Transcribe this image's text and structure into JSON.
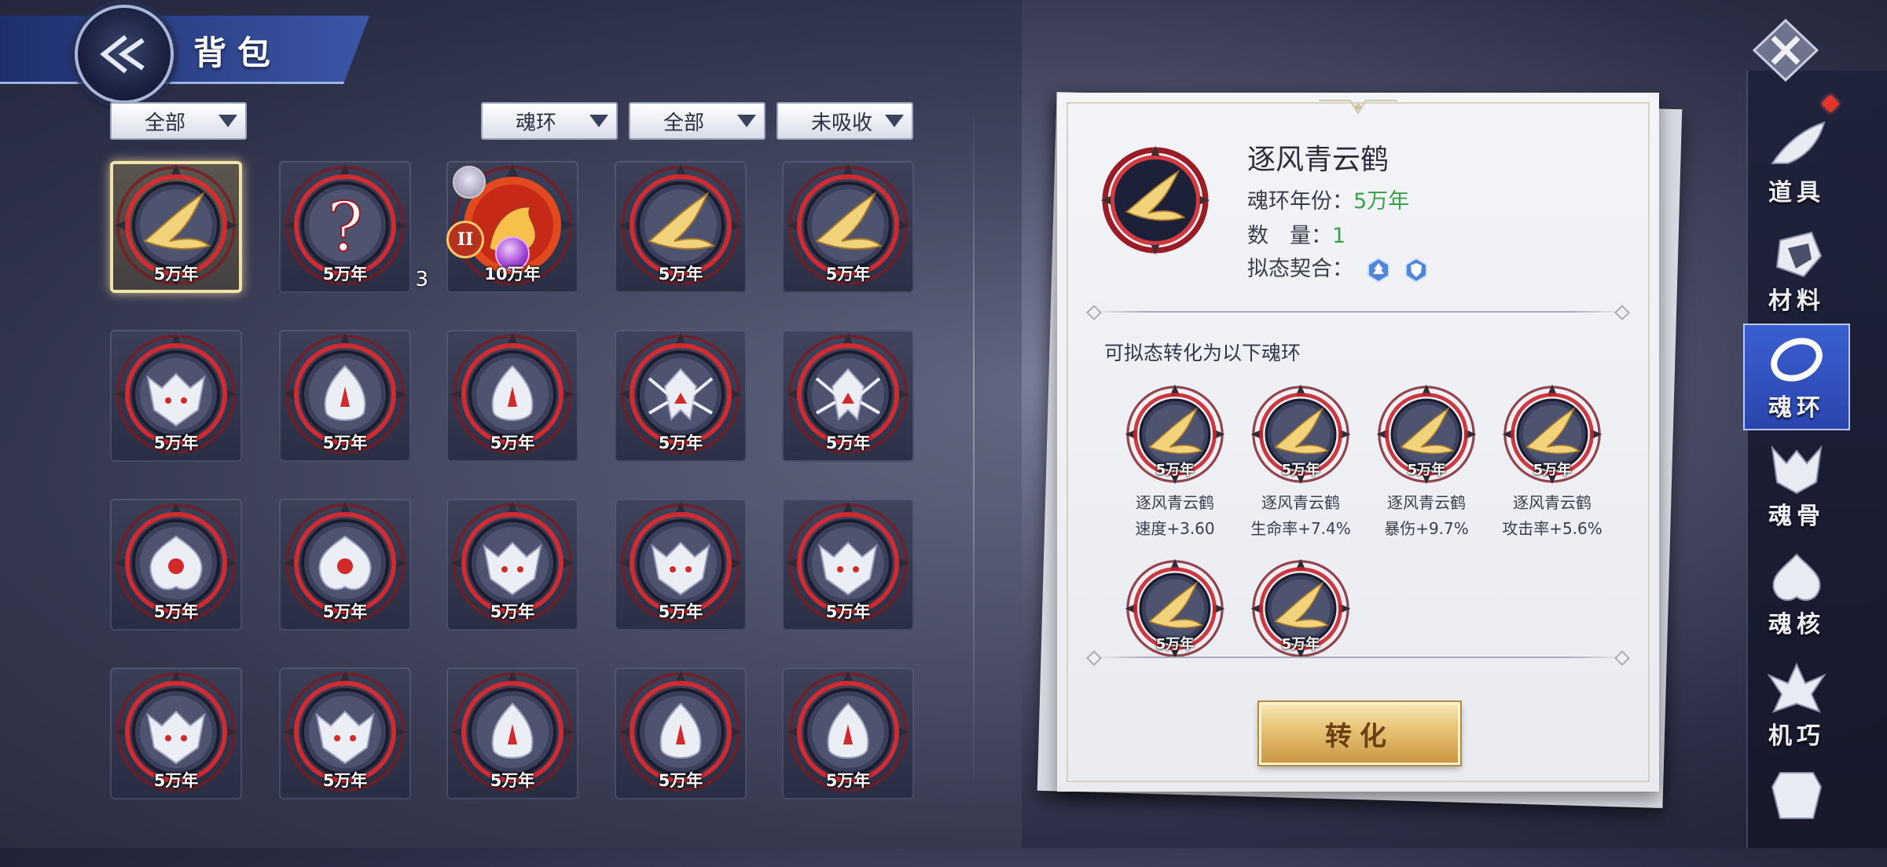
{
  "header": {
    "title": "背包"
  },
  "filters": {
    "category": "全部",
    "type": "魂环",
    "range": "全部",
    "absorb": "未吸收"
  },
  "inventory": [
    {
      "age": "5万年",
      "icon": "crane-icon",
      "selected": true
    },
    {
      "age": "5万年",
      "icon": "mystery-icon",
      "qty": "3"
    },
    {
      "age": "10万年",
      "icon": "fire-dragon-icon",
      "badge": "II"
    },
    {
      "age": "5万年",
      "icon": "crane-icon"
    },
    {
      "age": "5万年",
      "icon": "crane-icon"
    },
    {
      "age": "5万年",
      "icon": "wolf-icon"
    },
    {
      "age": "5万年",
      "icon": "fox-icon"
    },
    {
      "age": "5万年",
      "icon": "fox-icon"
    },
    {
      "age": "5万年",
      "icon": "spider-icon"
    },
    {
      "age": "5万年",
      "icon": "spider-icon"
    },
    {
      "age": "5万年",
      "icon": "flower-icon"
    },
    {
      "age": "5万年",
      "icon": "flower-icon"
    },
    {
      "age": "5万年",
      "icon": "wolf-icon"
    },
    {
      "age": "5万年",
      "icon": "wolf-icon"
    },
    {
      "age": "5万年",
      "icon": "wolf-icon"
    },
    {
      "age": "5万年",
      "icon": "wolf-icon"
    },
    {
      "age": "5万年",
      "icon": "wolf-icon"
    },
    {
      "age": "5万年",
      "icon": "fox-icon"
    },
    {
      "age": "5万年",
      "icon": "fox-icon"
    },
    {
      "age": "5万年",
      "icon": "fox-icon"
    }
  ],
  "detail": {
    "name": "逐风青云鹤",
    "age_label": "魂环年份：",
    "age_value": "5万年",
    "qty_label": "数　量：",
    "qty_value": "1",
    "match_label": "拟态契合：",
    "convert_title": "可拟态转化为以下魂环",
    "options": [
      {
        "age": "5万年",
        "name": "逐风青云鹤",
        "stat": "速度+3.60"
      },
      {
        "age": "5万年",
        "name": "逐风青云鹤",
        "stat": "生命率+7.4%"
      },
      {
        "age": "5万年",
        "name": "逐风青云鹤",
        "stat": "暴伤+9.7%"
      },
      {
        "age": "5万年",
        "name": "逐风青云鹤",
        "stat": "攻击率+5.6%"
      },
      {
        "age": "5万年",
        "name": "",
        "stat": ""
      },
      {
        "age": "5万年",
        "name": "",
        "stat": ""
      }
    ],
    "button": "转化"
  },
  "nav": [
    {
      "label": "道具",
      "icon": "feather-icon"
    },
    {
      "label": "材料",
      "icon": "ore-icon"
    },
    {
      "label": "魂环",
      "icon": "ring-icon",
      "active": true
    },
    {
      "label": "魂骨",
      "icon": "bone-icon"
    },
    {
      "label": "魂核",
      "icon": "core-icon"
    },
    {
      "label": "机巧",
      "icon": "mech-icon"
    },
    {
      "label": "",
      "icon": "armor-icon"
    }
  ],
  "colors": {
    "accent_green": "#3aa14a",
    "ring_red": "#c8242a",
    "gold": "#e8c477",
    "nav_active": "#2a46ad"
  }
}
